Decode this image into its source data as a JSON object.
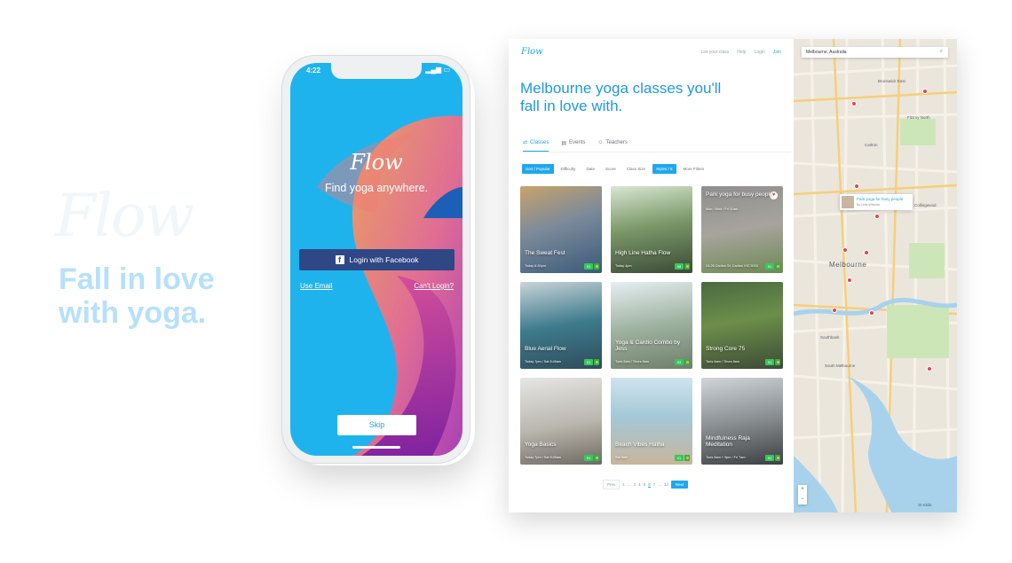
{
  "hero": {
    "bg_logo": "Flow",
    "tagline": "Fall in love with yoga."
  },
  "phone": {
    "time": "4:22",
    "logo": "Flow",
    "subtitle": "Find yoga anywhere.",
    "facebook_button": "Login with Facebook",
    "use_email": "Use Email",
    "cant_login": "Can't Login?",
    "skip": "Skip"
  },
  "site": {
    "logo": "Flow",
    "nav": [
      "List your class",
      "Help",
      "Login",
      "Join"
    ],
    "headline": "Melbourne yoga classes you'll fall in love with.",
    "tabs": [
      {
        "label": "Classes",
        "icon": "shuffle-icon"
      },
      {
        "label": "Events",
        "icon": "calendar-icon"
      },
      {
        "label": "Teachers",
        "icon": "person-icon"
      }
    ],
    "filters": [
      "Sort / Popular",
      "Difficulty",
      "Date",
      "Score",
      "Class Size",
      "Styles / 5",
      "More Filters"
    ],
    "cards": [
      {
        "title": "The Sweat Fest",
        "sub": "Today 6:30pm",
        "score": "91"
      },
      {
        "title": "High Line Hatha Flow",
        "sub": "Today 4pm",
        "score": "98"
      },
      {
        "title": "Park yoga for busy people",
        "sub": "Mon / Wed / Fri 11am",
        "sub2": "24-26 Carlton St, Carlton VIC 3053",
        "score": "91"
      },
      {
        "title": "Blue Aerial Flow",
        "sub": "Today 7pm / Sat 8:45am",
        "score": "91"
      },
      {
        "title": "Yoga & Cardio Combo by Jess",
        "sub": "Tues 6am / Thurs 8am",
        "score": "93"
      },
      {
        "title": "Strong Core 75",
        "sub": "Tues 6am / Thurs 8am",
        "score": "91"
      },
      {
        "title": "Yoga Basics",
        "sub": "Today 7pm / Sat 8:45am",
        "score": "91"
      },
      {
        "title": "Beach Vibes Hatha",
        "sub": "Sat 9am",
        "score": "91"
      },
      {
        "title": "Mindfulness Raja Meditation",
        "sub": "Tues 6am + 9pm / Fri 7am",
        "score": "91"
      }
    ],
    "pager": {
      "prev": "Prev",
      "pages": [
        "1",
        "...",
        "3",
        "4",
        "5",
        "6",
        "7",
        "...",
        "32"
      ],
      "current": "6",
      "next": "Next"
    },
    "map": {
      "search": "Melbourne, Australia",
      "popup_title": "Park yoga for busy people",
      "popup_sub": "By Leila Wheeler",
      "labels": [
        "Brunswick East",
        "Fitzroy North",
        "Carlton",
        "Collingwood",
        "Melbourne",
        "Southbank",
        "South Melbourne",
        "St Kilda"
      ],
      "zoom_in": "+",
      "zoom_out": "−"
    }
  },
  "colors": {
    "accent": "#1fa7ee",
    "facebook": "#2f4785",
    "score_green": "#37c75a",
    "tagline": "#b7e0fb"
  }
}
